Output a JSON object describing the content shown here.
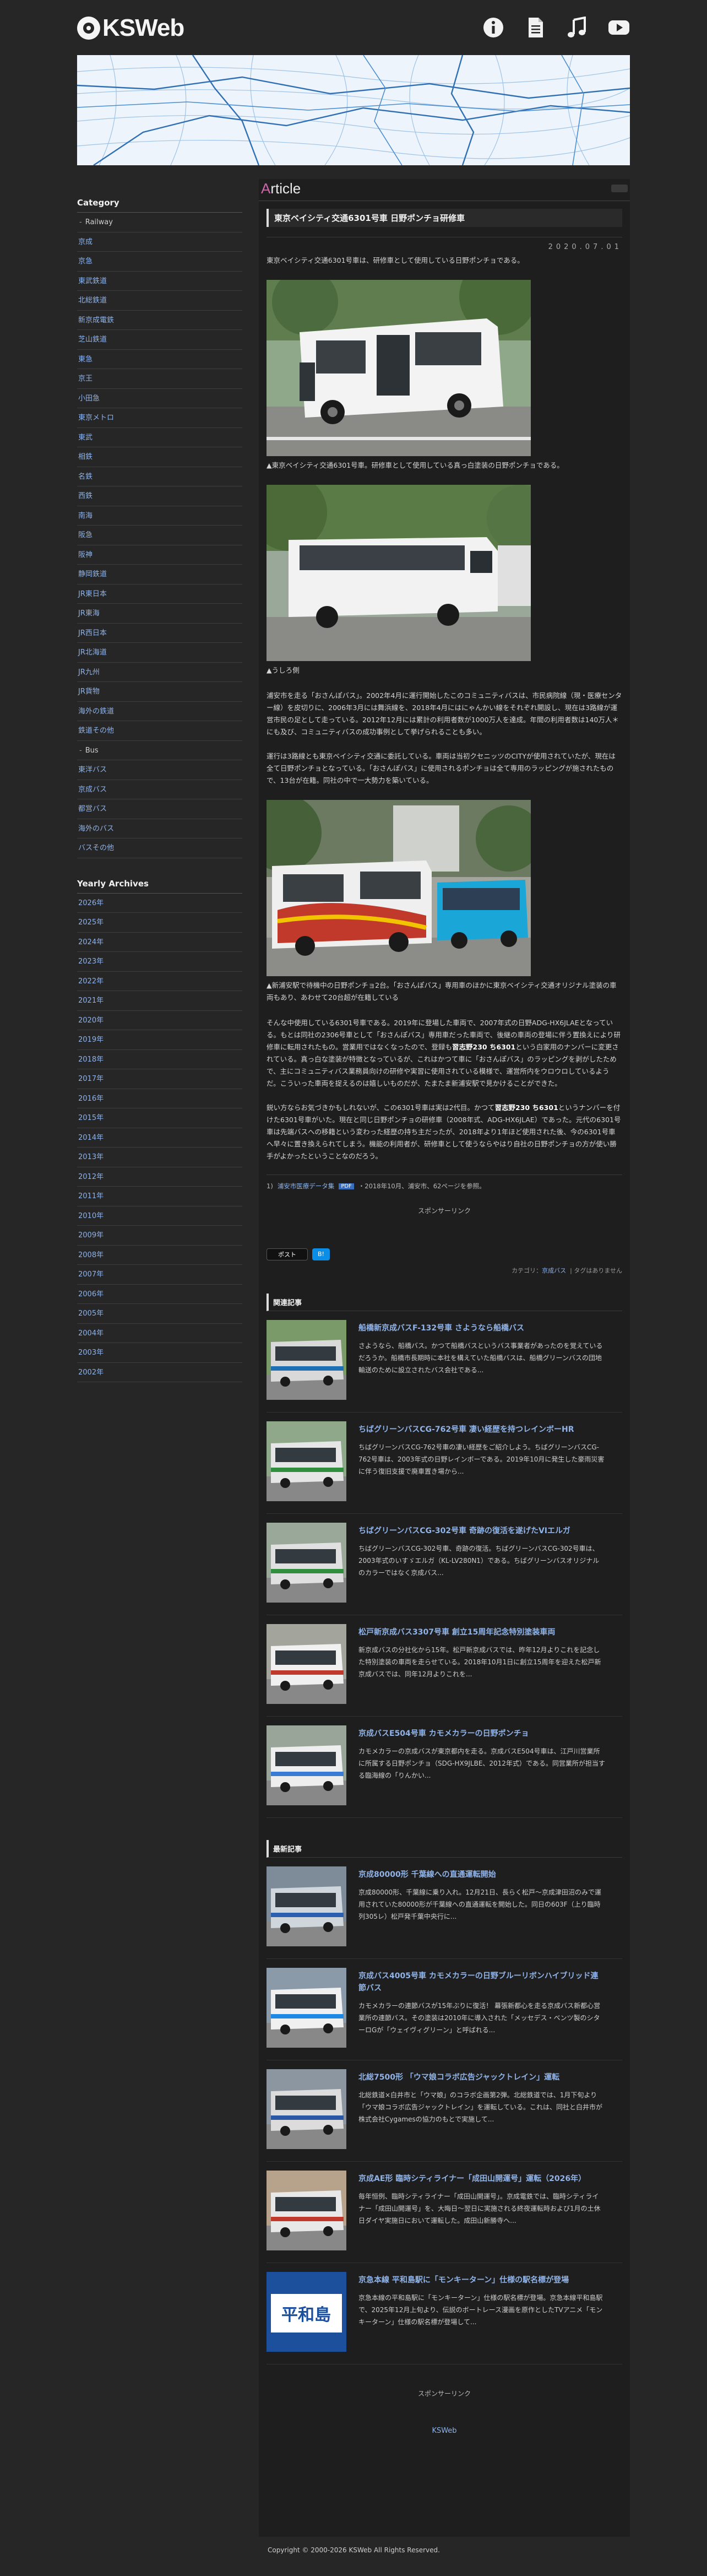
{
  "site": {
    "name": "KSWeb"
  },
  "header_icons": [
    "info-icon",
    "document-icon",
    "music-icon",
    "youtube-icon"
  ],
  "sidebar": {
    "category_title": "Category",
    "categories": [
      {
        "label": "Railway",
        "group": true
      },
      {
        "label": "京成"
      },
      {
        "label": "京急"
      },
      {
        "label": "東武鉄道"
      },
      {
        "label": "北総鉄道"
      },
      {
        "label": "新京成電鉄"
      },
      {
        "label": "芝山鉄道"
      },
      {
        "label": "東急"
      },
      {
        "label": "京王"
      },
      {
        "label": "小田急"
      },
      {
        "label": "東京メトロ"
      },
      {
        "label": "東武"
      },
      {
        "label": "相鉄"
      },
      {
        "label": "名鉄"
      },
      {
        "label": "西鉄"
      },
      {
        "label": "南海"
      },
      {
        "label": "阪急"
      },
      {
        "label": "阪神"
      },
      {
        "label": "静岡鉄道"
      },
      {
        "label": "JR東日本"
      },
      {
        "label": "JR東海"
      },
      {
        "label": "JR西日本"
      },
      {
        "label": "JR北海道"
      },
      {
        "label": "JR九州"
      },
      {
        "label": "JR貨物"
      },
      {
        "label": "海外の鉄道"
      },
      {
        "label": "鉄道その他"
      },
      {
        "label": "Bus",
        "group": true
      },
      {
        "label": "東洋バス"
      },
      {
        "label": "京成バス"
      },
      {
        "label": "都営バス"
      },
      {
        "label": "海外のバス"
      },
      {
        "label": "バスその他"
      }
    ],
    "years_title": "Yearly Archives",
    "years": [
      "2026年",
      "2025年",
      "2024年",
      "2023年",
      "2022年",
      "2021年",
      "2020年",
      "2019年",
      "2018年",
      "2017年",
      "2016年",
      "2015年",
      "2014年",
      "2013年",
      "2012年",
      "2011年",
      "2010年",
      "2009年",
      "2008年",
      "2007年",
      "2006年",
      "2005年",
      "2004年",
      "2003年",
      "2002年"
    ]
  },
  "main": {
    "section_label_initial": "A",
    "section_label_rest": "rticle",
    "title": "東京ベイシティ交通6301号車 日野ポンチョ研修車",
    "date": "2020.07.01",
    "intro": "東京ベイシティ交通6301号車は、研修車として使用している日野ポンチョである。",
    "cap1": "▲東京ベイシティ交通6301号車。研修車として使用している真っ白塗装の日野ポンチョである。",
    "cap2": "▲うしろ側",
    "para1": "浦安市を走る「おさんぽバス」。2002年4月に運行開始したこのコミュニティバスは、市民病院線（現・医療センター線）を皮切りに、2006年3月には舞浜線を、2018年4月にはにゃんかい線をそれぞれ開設し、現在は3路線が運営市民の足として走っている。2012年12月には累計の利用者数が1000万人を達成。年間の利用者数は140万人＊にも及び、コミュニティバスの成功事例として挙げられることも多い。",
    "para2": "運行は3路線とも東京ベイシティ交通に委託している。車両は当初クセニッツのCITYが使用されていたが、現在は全て日野ポンチョとなっている。「おさんぽバス」に使用されるポンチョは全て専用のラッピングが施されたもので、13台が在籍。同社の中で一大勢力を築いている。",
    "cap3": "▲新浦安駅で待機中の日野ポンチョ2台。「おさんぽバス」専用車のほかに東京ベイシティ交通オリジナル塗装の車両もあり、あわせて20台超が在籍している",
    "para3_a": "そんな中使用している6301号車である。2019年に登場した車両で、2007年式の日野ADG-HX6JLAEとなっている。もとは同社の2306号車として「おさんぽバス」専用車だった車両で、後継の車両の登場に伴う置換えにより研修車に転用されたもの。営業用ではなくなったので、登録も",
    "para3_b": "習志野230 ち6301",
    "para3_c": "という白家用のナンバーに変更されている。真っ白な塗装が特徴となっているが、これはかつて車に「おさんぽバス」のラッピングを剥がしたためで、主にコミュニティバス業務員向けの研修や実習に使用されている模様で、運営所内をウロウロしているようだ。こういった車両を捉えるのは嬉しいものだが、たまたま新浦安駅で見かけることができた。",
    "para4_a": "鋭い方ならお気づきかもしれないが、この6301号車は実は2代目。かつて",
    "para4_b": "習志野230 ち6301",
    "para4_c": "というナンバーを付けた6301号車がいた。現在と同じ日野ポンチョの研修車（2008年式、ADG-HX6JLAE）であった。元代の6301号車は先端バスへの移籍という変わった経歴の持ち主だったが、2018年より1年ほど使用された後、今の6301号車へ早々に置き換えられてしまう。機能の利用者が、研修車として使うならやはり自社の日野ポンチョの方が使い勝手がよかったということなのだろう。",
    "meta_note_index": "1)",
    "meta_tag": "浦安市医療データ集",
    "meta_new": "PDF",
    "meta_text": "・2018年10月、浦安市、62ページを参照。",
    "sponsor": "スポンサーリンク",
    "share_x": "ポスト",
    "share_hb": "B!",
    "cat_label": "カテゴリ：",
    "cat_value": "京成バス",
    "tag_label": "タグはありません",
    "related_title": "関連記事",
    "related": [
      {
        "title": "船橋新京成バスF-132号車 さようなら船橋バス",
        "desc": "さようなら、船橋バス。かつて船橋バスというバス事業者があったのを覚えているだろうか。船橋市長期時に本社を構えていた船橋バスは、船橋グリーンバスの団地輸送のために設立されたバス会社である..."
      },
      {
        "title": "ちばグリーンバスCG-762号車 凄い経歴を持つレインボーHR",
        "desc": "ちばグリーンバスCG-762号車の凄い経歴をご紹介しよう。ちばグリーンバスCG-762号車は、2003年式の日野レインボーである。2019年10月に発生した豪雨災害に伴う復旧支援で廃車置き場から..."
      },
      {
        "title": "ちばグリーンバスCG-302号車 奇跡の復活を遂げたVIエルガ",
        "desc": "ちばグリーンバスCG-302号車、奇跡の復活。ちばグリーンバスCG-302号車は、2003年式のいすゞエルガ（KL-LV280N1）である。ちばグリーンバスオリジナルのカラーではなく京成バス..."
      },
      {
        "title": "松戸新京成バス3307号車 創立15周年記念特別塗装車両",
        "desc": "新京成バスの分社化から15年。松戸新京成バスでは、昨年12月よりこれを記念した特別塗装の車両を走らせている。2018年10月1日に創立15周年を迎えた松戸新京成バスでは、同年12月よりこれを..."
      },
      {
        "title": "京成バスE504号車 カモメカラーの日野ポンチョ",
        "desc": "カモメカラーの京成バスが東京都内を走る。京成バスE504号車は、江戸川営業所に所属する日野ポンチョ（SDG-HX9JLBE、2012年式）である。同営業所が担当する臨海線の「りんかい..."
      }
    ],
    "latest_title": "最新記事",
    "latest": [
      {
        "title": "京成80000形 千葉線への直通運転開始",
        "desc": "京成80000形、千葉線に乗り入れ。12月21日、長らく松戸～京成津田沼のみで運用されていた80000形が千葉線への直通運転を開始した。同日の603F（上り臨時列305レ）松戸発千葉中央行に..."
      },
      {
        "title": "京成バス4005号車 カモメカラーの日野ブルーリボンハイブリッド連節バス",
        "desc": "カモメカラーの連節バスが15年ぶりに復活！ 幕張新都心を走る京成バス新都心営業所の連節バス。その塗装は2010年に導入された「メッセデス・ベンツ製のシターロGが「ウェイヴィグリーン」と呼ばれる..."
      },
      {
        "title": "北総7500形 「ウマ娘コラボ広告ジャックトレイン」運転",
        "desc": "北総鉄道×白井市と「ウマ娘」のコラボ企画第2弾。北総鉄道では、1月下旬より「ウマ娘コラボ広告ジャックトレイン」を運転している。これは、同社と白井市が株式会社Cygamesの協力のもとで実施して..."
      },
      {
        "title": "京成AE形 臨時シティライナー「成田山開運号」運転（2026年）",
        "desc": "毎年恒例、臨時シティライナー「成田山開運号」。京成電鉄では、臨時シティライナー「成田山開運号」を、大晦日～翌日に実施される終夜運転時および1月の土休日ダイヤ実施日において運転した。成田山新勝寺へ..."
      },
      {
        "title": "京急本線 平和島駅に「モンキーターン」仕様の駅名標が登場",
        "desc": "京急本線の平和島駅に「モンキーターン」仕様の駅名標が登場。京急本線平和島駅で、2025年12月上旬より、伝説のボートレース漫画を原作としたTVアニメ「モンキーターン」仕様の駅名標が登場して..."
      }
    ],
    "station_sign_text": "平和島",
    "footer_sponsor": "スポンサーリンク",
    "footer_link": "KSWeb"
  },
  "copyright": "Copyright © 2000-2026 KSWeb All Rights Reserved.",
  "colors": {
    "background": "#262626",
    "panel": "#1e1e1e",
    "link": "#8fb3e8",
    "accent": "#cc66aa"
  }
}
